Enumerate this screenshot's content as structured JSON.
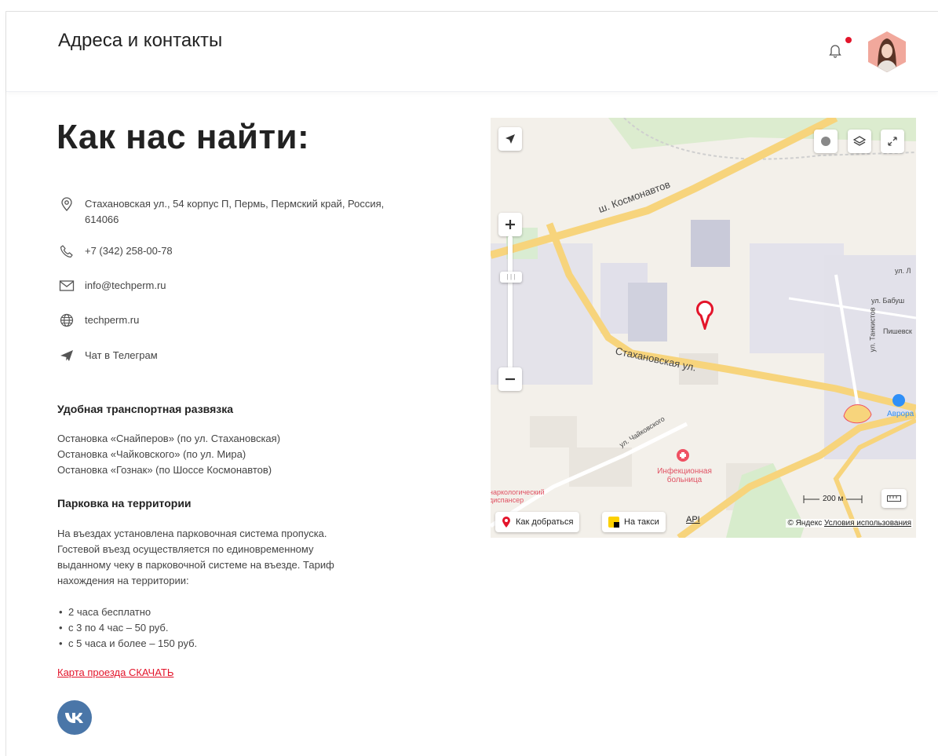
{
  "header": {
    "title": "Адреса и контакты"
  },
  "main": {
    "title": "Как нас найти:",
    "contacts": {
      "address": "Стахановская ул., 54 корпус П, Пермь, Пермский край, Россия, 614066",
      "phone": "+7 (342) 258-00-78",
      "email": "info@techperm.ru",
      "website": "techperm.ru",
      "telegram": "Чат в Телеграм"
    },
    "transport": {
      "heading": "Удобная транспортная развязка",
      "stops": [
        "Остановка «Снайперов» (по ул. Стахановская)",
        "Остановка «Чайковского» (по ул. Мира)",
        "Остановка «Гознак» (по Шоссе Космонавтов)"
      ]
    },
    "parking": {
      "heading": "Парковка на территории",
      "text_lines": [
        "На въездах установлена парковочная система пропуска.",
        "Гостевой въезд осуществляется по единовременному",
        "выданному чеку в парковочной системе на въезде. Тариф",
        "нахождения на территории:"
      ],
      "tariffs": [
        "2 часа бесплатно",
        "с 3 по 4 час – 50 руб.",
        "с 5 часа и более – 150 руб."
      ]
    },
    "download_link": "Карта проезда СКАЧАТЬ"
  },
  "map": {
    "street_labels": {
      "kosmonavtov": "ш. Космонавтов",
      "stakhanovskaya": "Стахановская ул.",
      "chaikovskogo": "ул. Чайковского",
      "babushkina": "ул. Бабуш",
      "tankistov": "ул. Танкистов",
      "pishev": "Пишевск",
      "ul_l": "ул. Л",
      "hospital": "Инфекционная больница",
      "avrora": "Аврора",
      "onko": "наркологический диспансер"
    },
    "route_button": "Как добраться",
    "taxi_button": "На такси",
    "api_link": "API",
    "scale": "200 м",
    "copyright": "© Яндекс",
    "terms": "Условия использования"
  },
  "colors": {
    "accent": "#e3152b",
    "vk": "#4a76a8"
  }
}
